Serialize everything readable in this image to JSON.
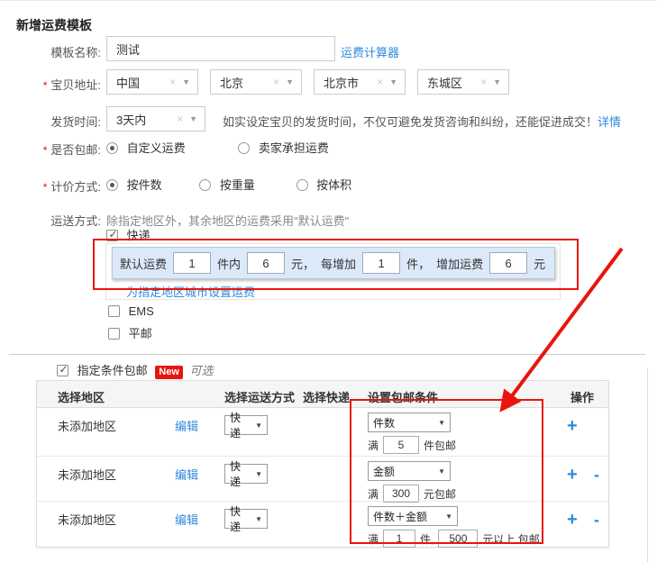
{
  "page": {
    "title": "新增运费模板",
    "required_mark": "*"
  },
  "icons": {
    "clear": "×",
    "dropdown": "▼",
    "check": "✓"
  },
  "form": {
    "template_name": {
      "label": "模板名称:",
      "value": "测试",
      "calculator_link": "运费计算器"
    },
    "item_address": {
      "label": "宝贝地址:",
      "regions": [
        "中国",
        "北京",
        "北京市",
        "东城区"
      ]
    },
    "delivery_time": {
      "label": "发货时间:",
      "value": "3天内",
      "hint": "如实设定宝贝的发货时间，不仅可避免发货咨询和纠纷，还能促进成交！",
      "detail_link": "详情"
    },
    "free_shipping": {
      "label": "是否包邮:",
      "option1": "自定义运费",
      "option2": "卖家承担运费"
    },
    "pricing_method": {
      "label": "计价方式:",
      "option1": "按件数",
      "option2": "按重量",
      "option3": "按体积"
    },
    "shipping_method": {
      "label": "运送方式:",
      "note": "除指定地区外，其余地区的运费采用\"默认运费\"",
      "express_label": "快递",
      "default_fee": {
        "label": "默认运费",
        "within_value": "1",
        "within_unit": "件内",
        "fee_value": "6",
        "fee_unit": "元，",
        "increment_label": "每增加",
        "increment_value": "1",
        "increment_unit": "件，",
        "add_fee_label": "增加运费",
        "add_fee_value": "6",
        "add_fee_unit": "元"
      },
      "city_fee_link": "为指定地区城市设置运费",
      "ems_label": "EMS",
      "ordinary_label": "平邮"
    }
  },
  "condition": {
    "checkbox_label": "指定条件包邮",
    "badge": "New",
    "optional_note": "可选",
    "table": {
      "headers": [
        "选择地区",
        "选择运送方式",
        "选择快递",
        "设置包邮条件",
        "操作"
      ],
      "ops": {
        "add": "+",
        "remove": "-"
      },
      "rows": [
        {
          "area": "未添加地区",
          "edit": "编辑",
          "method": "快递",
          "cond_type": "件数",
          "prefix": "满",
          "value1": "5",
          "suffix": "件包邮"
        },
        {
          "area": "未添加地区",
          "edit": "编辑",
          "method": "快递",
          "cond_type": "金额",
          "prefix": "满",
          "value1": "300",
          "suffix": "元包邮"
        },
        {
          "area": "未添加地区",
          "edit": "编辑",
          "method": "快递",
          "cond_type": "件数＋金额",
          "prefix": "满",
          "value1": "1",
          "mid": "件,",
          "value2": "500",
          "suffix": "元以上 包邮"
        }
      ]
    }
  },
  "colors": {
    "link_blue": "#3089dc",
    "annotation_red": "#e9150d",
    "highlight_row_bg": "#dce9f8"
  }
}
